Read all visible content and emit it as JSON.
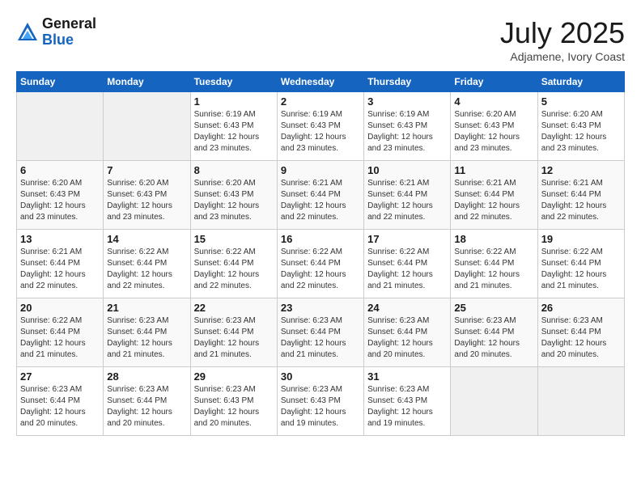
{
  "header": {
    "logo_general": "General",
    "logo_blue": "Blue",
    "month_title": "July 2025",
    "location": "Adjamene, Ivory Coast"
  },
  "weekdays": [
    "Sunday",
    "Monday",
    "Tuesday",
    "Wednesday",
    "Thursday",
    "Friday",
    "Saturday"
  ],
  "weeks": [
    [
      {
        "day": "",
        "detail": ""
      },
      {
        "day": "",
        "detail": ""
      },
      {
        "day": "1",
        "detail": "Sunrise: 6:19 AM\nSunset: 6:43 PM\nDaylight: 12 hours\nand 23 minutes."
      },
      {
        "day": "2",
        "detail": "Sunrise: 6:19 AM\nSunset: 6:43 PM\nDaylight: 12 hours\nand 23 minutes."
      },
      {
        "day": "3",
        "detail": "Sunrise: 6:19 AM\nSunset: 6:43 PM\nDaylight: 12 hours\nand 23 minutes."
      },
      {
        "day": "4",
        "detail": "Sunrise: 6:20 AM\nSunset: 6:43 PM\nDaylight: 12 hours\nand 23 minutes."
      },
      {
        "day": "5",
        "detail": "Sunrise: 6:20 AM\nSunset: 6:43 PM\nDaylight: 12 hours\nand 23 minutes."
      }
    ],
    [
      {
        "day": "6",
        "detail": "Sunrise: 6:20 AM\nSunset: 6:43 PM\nDaylight: 12 hours\nand 23 minutes."
      },
      {
        "day": "7",
        "detail": "Sunrise: 6:20 AM\nSunset: 6:43 PM\nDaylight: 12 hours\nand 23 minutes."
      },
      {
        "day": "8",
        "detail": "Sunrise: 6:20 AM\nSunset: 6:43 PM\nDaylight: 12 hours\nand 23 minutes."
      },
      {
        "day": "9",
        "detail": "Sunrise: 6:21 AM\nSunset: 6:44 PM\nDaylight: 12 hours\nand 22 minutes."
      },
      {
        "day": "10",
        "detail": "Sunrise: 6:21 AM\nSunset: 6:44 PM\nDaylight: 12 hours\nand 22 minutes."
      },
      {
        "day": "11",
        "detail": "Sunrise: 6:21 AM\nSunset: 6:44 PM\nDaylight: 12 hours\nand 22 minutes."
      },
      {
        "day": "12",
        "detail": "Sunrise: 6:21 AM\nSunset: 6:44 PM\nDaylight: 12 hours\nand 22 minutes."
      }
    ],
    [
      {
        "day": "13",
        "detail": "Sunrise: 6:21 AM\nSunset: 6:44 PM\nDaylight: 12 hours\nand 22 minutes."
      },
      {
        "day": "14",
        "detail": "Sunrise: 6:22 AM\nSunset: 6:44 PM\nDaylight: 12 hours\nand 22 minutes."
      },
      {
        "day": "15",
        "detail": "Sunrise: 6:22 AM\nSunset: 6:44 PM\nDaylight: 12 hours\nand 22 minutes."
      },
      {
        "day": "16",
        "detail": "Sunrise: 6:22 AM\nSunset: 6:44 PM\nDaylight: 12 hours\nand 22 minutes."
      },
      {
        "day": "17",
        "detail": "Sunrise: 6:22 AM\nSunset: 6:44 PM\nDaylight: 12 hours\nand 21 minutes."
      },
      {
        "day": "18",
        "detail": "Sunrise: 6:22 AM\nSunset: 6:44 PM\nDaylight: 12 hours\nand 21 minutes."
      },
      {
        "day": "19",
        "detail": "Sunrise: 6:22 AM\nSunset: 6:44 PM\nDaylight: 12 hours\nand 21 minutes."
      }
    ],
    [
      {
        "day": "20",
        "detail": "Sunrise: 6:22 AM\nSunset: 6:44 PM\nDaylight: 12 hours\nand 21 minutes."
      },
      {
        "day": "21",
        "detail": "Sunrise: 6:23 AM\nSunset: 6:44 PM\nDaylight: 12 hours\nand 21 minutes."
      },
      {
        "day": "22",
        "detail": "Sunrise: 6:23 AM\nSunset: 6:44 PM\nDaylight: 12 hours\nand 21 minutes."
      },
      {
        "day": "23",
        "detail": "Sunrise: 6:23 AM\nSunset: 6:44 PM\nDaylight: 12 hours\nand 21 minutes."
      },
      {
        "day": "24",
        "detail": "Sunrise: 6:23 AM\nSunset: 6:44 PM\nDaylight: 12 hours\nand 20 minutes."
      },
      {
        "day": "25",
        "detail": "Sunrise: 6:23 AM\nSunset: 6:44 PM\nDaylight: 12 hours\nand 20 minutes."
      },
      {
        "day": "26",
        "detail": "Sunrise: 6:23 AM\nSunset: 6:44 PM\nDaylight: 12 hours\nand 20 minutes."
      }
    ],
    [
      {
        "day": "27",
        "detail": "Sunrise: 6:23 AM\nSunset: 6:44 PM\nDaylight: 12 hours\nand 20 minutes."
      },
      {
        "day": "28",
        "detail": "Sunrise: 6:23 AM\nSunset: 6:44 PM\nDaylight: 12 hours\nand 20 minutes."
      },
      {
        "day": "29",
        "detail": "Sunrise: 6:23 AM\nSunset: 6:43 PM\nDaylight: 12 hours\nand 20 minutes."
      },
      {
        "day": "30",
        "detail": "Sunrise: 6:23 AM\nSunset: 6:43 PM\nDaylight: 12 hours\nand 19 minutes."
      },
      {
        "day": "31",
        "detail": "Sunrise: 6:23 AM\nSunset: 6:43 PM\nDaylight: 12 hours\nand 19 minutes."
      },
      {
        "day": "",
        "detail": ""
      },
      {
        "day": "",
        "detail": ""
      }
    ]
  ]
}
